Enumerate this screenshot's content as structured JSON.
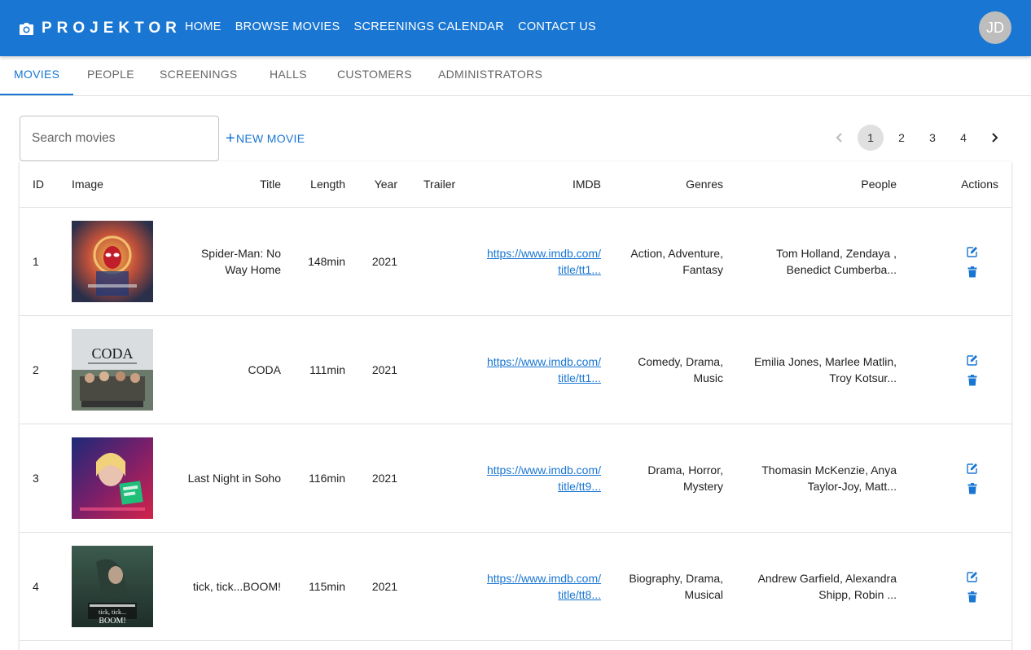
{
  "header": {
    "brand": "PROJEKTOR",
    "nav": [
      "HOME",
      "BROWSE MOVIES",
      "SCREENINGS CALENDAR",
      "CONTACT US"
    ],
    "avatar_initials": "JD",
    "color": "#1976d2"
  },
  "tabs": [
    "MOVIES",
    "PEOPLE",
    "SCREENINGS",
    "HALLS",
    "CUSTOMERS",
    "ADMINISTRATORS"
  ],
  "active_tab": "MOVIES",
  "toolbar": {
    "search_placeholder": "Search movies",
    "new_movie_label": "NEW MOVIE",
    "plus": "+"
  },
  "pagination": {
    "pages": [
      "1",
      "2",
      "3",
      "4"
    ],
    "current": "1"
  },
  "table": {
    "columns": [
      "ID",
      "Image",
      "Title",
      "Length",
      "Year",
      "Trailer",
      "IMDB",
      "Genres",
      "People",
      "Actions"
    ],
    "rows": [
      {
        "id": "1",
        "poster_icon": "spider-man-no-way-home-poster",
        "title_line1": "Spider-Man: No",
        "title_line2": "Way Home",
        "length": "148min",
        "year": "2021",
        "trailer": "",
        "imdb_line1": "https://www.imdb.com/",
        "imdb_line2": "title/tt1...",
        "genres_line1": "Action, Adventure,",
        "genres_line2": "Fantasy",
        "people_line1": "Tom Holland, Zendaya ,",
        "people_line2": "Benedict Cumberba..."
      },
      {
        "id": "2",
        "poster_icon": "coda-poster",
        "title_line1": "CODA",
        "title_line2": "",
        "length": "111min",
        "year": "2021",
        "trailer": "",
        "imdb_line1": "https://www.imdb.com/",
        "imdb_line2": "title/tt1...",
        "genres_line1": "Comedy, Drama,",
        "genres_line2": "Music",
        "people_line1": "Emilia Jones, Marlee Matlin,",
        "people_line2": "Troy Kotsur..."
      },
      {
        "id": "3",
        "poster_icon": "last-night-in-soho-poster",
        "title_line1": "Last Night in Soho",
        "title_line2": "",
        "length": "116min",
        "year": "2021",
        "trailer": "",
        "imdb_line1": "https://www.imdb.com/",
        "imdb_line2": "title/tt9...",
        "genres_line1": "Drama, Horror,",
        "genres_line2": "Mystery",
        "people_line1": "Thomasin McKenzie, Anya",
        "people_line2": "Taylor-Joy, Matt..."
      },
      {
        "id": "4",
        "poster_icon": "tick-tick-boom-poster",
        "title_line1": "tick, tick...BOOM!",
        "title_line2": "",
        "length": "115min",
        "year": "2021",
        "trailer": "",
        "imdb_line1": "https://www.imdb.com/",
        "imdb_line2": "title/tt8...",
        "genres_line1": "Biography, Drama,",
        "genres_line2": "Musical",
        "people_line1": "Andrew Garfield, Alexandra",
        "people_line2": "Shipp, Robin ..."
      }
    ]
  },
  "poster_texts": {
    "coda": "CODA",
    "tick": "tick, tick...",
    "boom": "BOOM!"
  }
}
